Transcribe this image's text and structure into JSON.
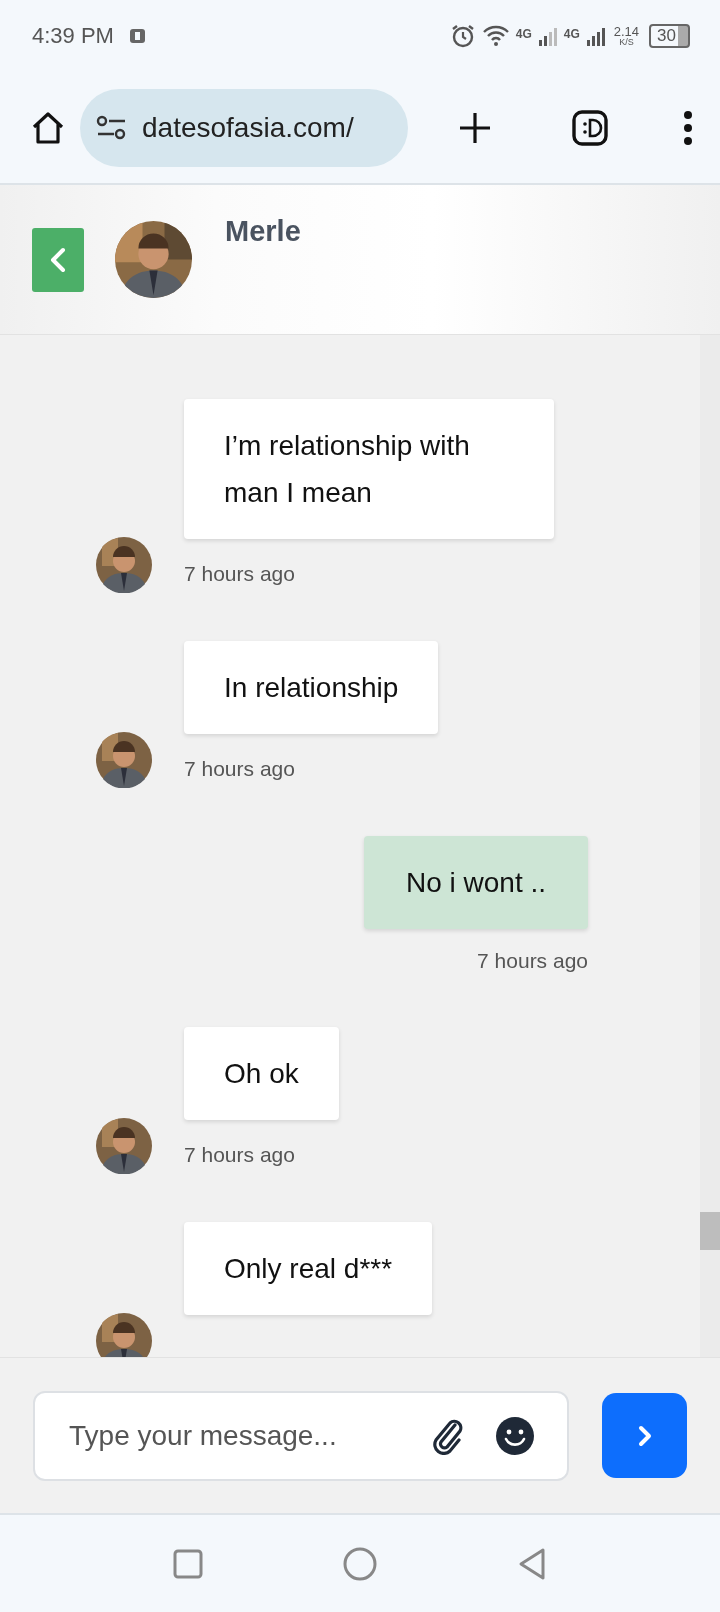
{
  "status_bar": {
    "time": "4:39 PM",
    "network_1": "4G",
    "network_2": "4G",
    "speed": "2.14",
    "speed_unit": "K/S",
    "battery": "30"
  },
  "browser": {
    "url": "datesofasia.com/"
  },
  "chat_header": {
    "name": "Merle"
  },
  "messages": [
    {
      "kind": "received",
      "text": "I’m relationship with man I mean",
      "time": "7 hours ago"
    },
    {
      "kind": "received",
      "text": "In relationship",
      "time": "7 hours ago"
    },
    {
      "kind": "sent",
      "text": "No i wont ..",
      "time": "7 hours ago"
    },
    {
      "kind": "received",
      "text": "Oh ok",
      "time": "7 hours ago"
    },
    {
      "kind": "received",
      "text": "Only real d***"
    }
  ],
  "composer": {
    "placeholder": "Type your message..."
  }
}
